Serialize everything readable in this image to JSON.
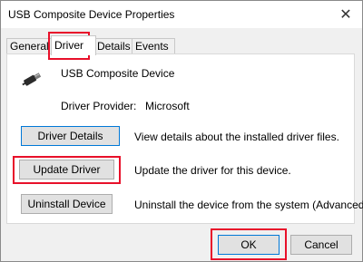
{
  "window": {
    "title": "USB Composite Device Properties"
  },
  "tabs": [
    {
      "label": "General"
    },
    {
      "label": "Driver"
    },
    {
      "label": "Details"
    },
    {
      "label": "Events"
    }
  ],
  "device": {
    "name": "USB Composite Device",
    "provider_label": "Driver Provider:",
    "provider_value": "Microsoft"
  },
  "actions": [
    {
      "button": "Driver Details",
      "description": "View details about the installed driver files."
    },
    {
      "button": "Update Driver",
      "description": "Update the driver for this device."
    },
    {
      "button": "Uninstall Device",
      "description": "Uninstall the device from the system (Advanced)."
    }
  ],
  "footer": {
    "ok": "OK",
    "cancel": "Cancel"
  },
  "colors": {
    "highlight": "#e8102a",
    "focus": "#0078d7"
  }
}
